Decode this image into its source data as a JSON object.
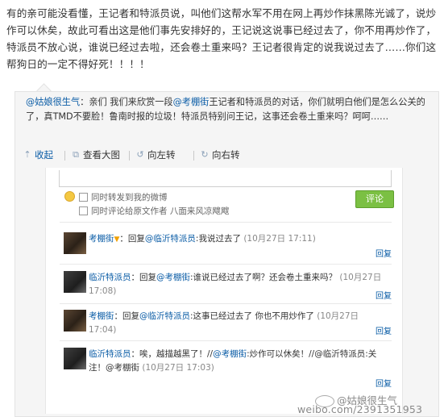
{
  "post": {
    "text": "有的亲可能没看懂，王记者和特派员说，叫他们这帮水军不用在网上再炒作抹黑陈光诚了，说炒作可以休矣，故此可看出这是他们事先安排好的，王记说这说事已经过去了，你不用再炒作了，特派员不放心说，谁说已经过去啦，还会卷土重来吗？王记者很肯定的说我说过去了……你们这帮狗日的一定不得好死！！！！"
  },
  "repost": {
    "author": "@姑娘很生气",
    "colon": "：亲们 我们来欣赏一段",
    "mention": "@考棚街",
    "rest": "王记者和特派员的对话，你们就明白他们是怎么公关的了，真TMD不要脸！鲁南时报的垃圾！特派员特别问王记，这事还会卷土重来吗？呵呵……"
  },
  "toolbar": {
    "collapse": "收起",
    "view_large": "查看大图",
    "rotate_left": "向左转",
    "rotate_right": "向右转"
  },
  "composer": {
    "checkbox1": "同时转发到我的微博",
    "checkbox2": "同时评论给原文作者 八面来风凉飕飕",
    "comment_button": "评论"
  },
  "comments": [
    {
      "name": "考棚街",
      "prefix": "：回复",
      "mention": "@临沂特派员",
      "body": ":我说过去了",
      "time": "(10月27日 17:11)",
      "reply": "回复"
    },
    {
      "name": "临沂特派员",
      "prefix": "：回复",
      "mention": "@考棚街",
      "body": ":谁说已经过去了啊？还会卷土重来吗？",
      "time": "(10月27日 17:08)",
      "reply": "回复"
    },
    {
      "name": "考棚街",
      "prefix": "：回复",
      "mention": "@临沂特派员",
      "body": ":这事已经过去了 你也不用炒作了",
      "time": "(10月27日 17:04)",
      "reply": "回复"
    },
    {
      "name": "临沂特派员",
      "prefix": "：唉，越描越黑了！//",
      "mention": "@考棚街",
      "body": ":炒作可以休矣！//@临沂特派员:关注！@考棚街",
      "time": "(10月27日 17:03)",
      "reply": "回复"
    }
  ],
  "watermark": {
    "name": "@姑娘很生气",
    "url": "weibo.com/2391351953"
  }
}
